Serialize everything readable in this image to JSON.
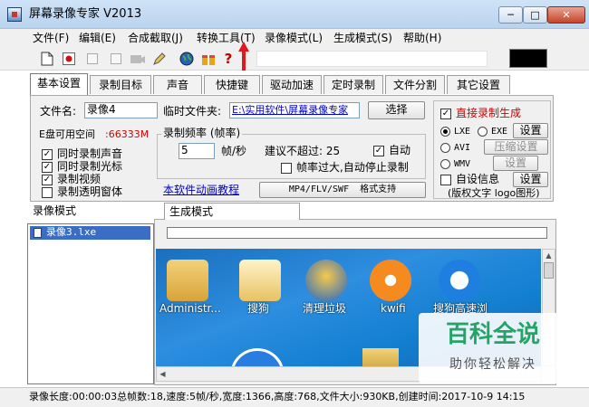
{
  "window": {
    "title": "屏幕录像专家 V2013",
    "close_glyph": "✕",
    "max_glyph": "□",
    "min_glyph": "─"
  },
  "menu": [
    "文件(F)",
    "编辑(E)",
    "合成截取(J)",
    "转换工具(T)",
    "录像模式(L)",
    "生成模式(S)",
    "帮助(H)"
  ],
  "toolbar": {
    "icons": [
      "new-file-icon",
      "record-icon",
      "pause-icon",
      "stop-icon",
      "camera-icon",
      "pen-icon",
      "globe-icon",
      "gift-icon",
      "help-icon"
    ],
    "help_glyph": "?"
  },
  "tabs": [
    "基本设置",
    "录制目标",
    "声音",
    "快捷键",
    "驱动加速",
    "定时录制",
    "文件分割",
    "其它设置"
  ],
  "basic": {
    "filename_label": "文件名:",
    "filename_value": "录像4",
    "tempfolder_label": "临时文件夹:",
    "tempfolder_value": "E:\\实用软件\\屏幕录像专家",
    "choose_button": "选择",
    "disk_label": "E盘可用空间",
    "disk_value": ":66333M",
    "checkboxes": [
      {
        "label": "同时录制声音",
        "checked": true
      },
      {
        "label": "同时录制光标",
        "checked": true
      },
      {
        "label": "录制视频",
        "checked": true
      },
      {
        "label": "录制透明窗体",
        "checked": false
      }
    ],
    "fps_legend": "录制频率 (帧率)",
    "fps_value": "5",
    "fps_unit": "帧/秒",
    "fps_hint": "建议不超过: 25",
    "auto_label": "自动",
    "auto_checked": true,
    "overflow_label": "帧率过大,自动停止录制",
    "overflow_checked": false,
    "tutorial_link": "本软件动画教程",
    "format_button": "MP4/FLV/SWF  格式支持"
  },
  "generate": {
    "direct_label": "直接录制生成",
    "direct_checked": true,
    "formats": [
      {
        "label": "LXE",
        "selected": true
      },
      {
        "label": "EXE",
        "selected": false
      },
      {
        "label": "AVI",
        "selected": false
      },
      {
        "label": "WMV",
        "selected": false
      }
    ],
    "settings_button": "设置",
    "compress_button": "压缩设置",
    "settings_button_disabled": "设置",
    "custom_info_label": "自设信息",
    "custom_info_checked": false,
    "custom_info_button": "设置",
    "custom_info_note": "(版权文字 logo图形)"
  },
  "left_panel": {
    "header": "录像模式",
    "items": [
      "录像3.lxe"
    ]
  },
  "right_panel": {
    "tab": "生成模式"
  },
  "desktop_icons": [
    "Administr...",
    "搜狗",
    "清理垃圾",
    "kwifi",
    "搜狗高速浏"
  ],
  "statusbar": "录像长度:00:00:03总帧数:18,速度:5帧/秒,宽度:1366,高度:768,文件大小:930KB,创建时间:2017-10-9 14:15",
  "watermark": {
    "title": "百科全说",
    "subtitle": "助你轻松解决"
  },
  "colors": {
    "accent_red": "#d00000",
    "link_blue": "#0000cc",
    "selection_blue": "#3a6ec5",
    "watermark_green": "#24a565"
  }
}
